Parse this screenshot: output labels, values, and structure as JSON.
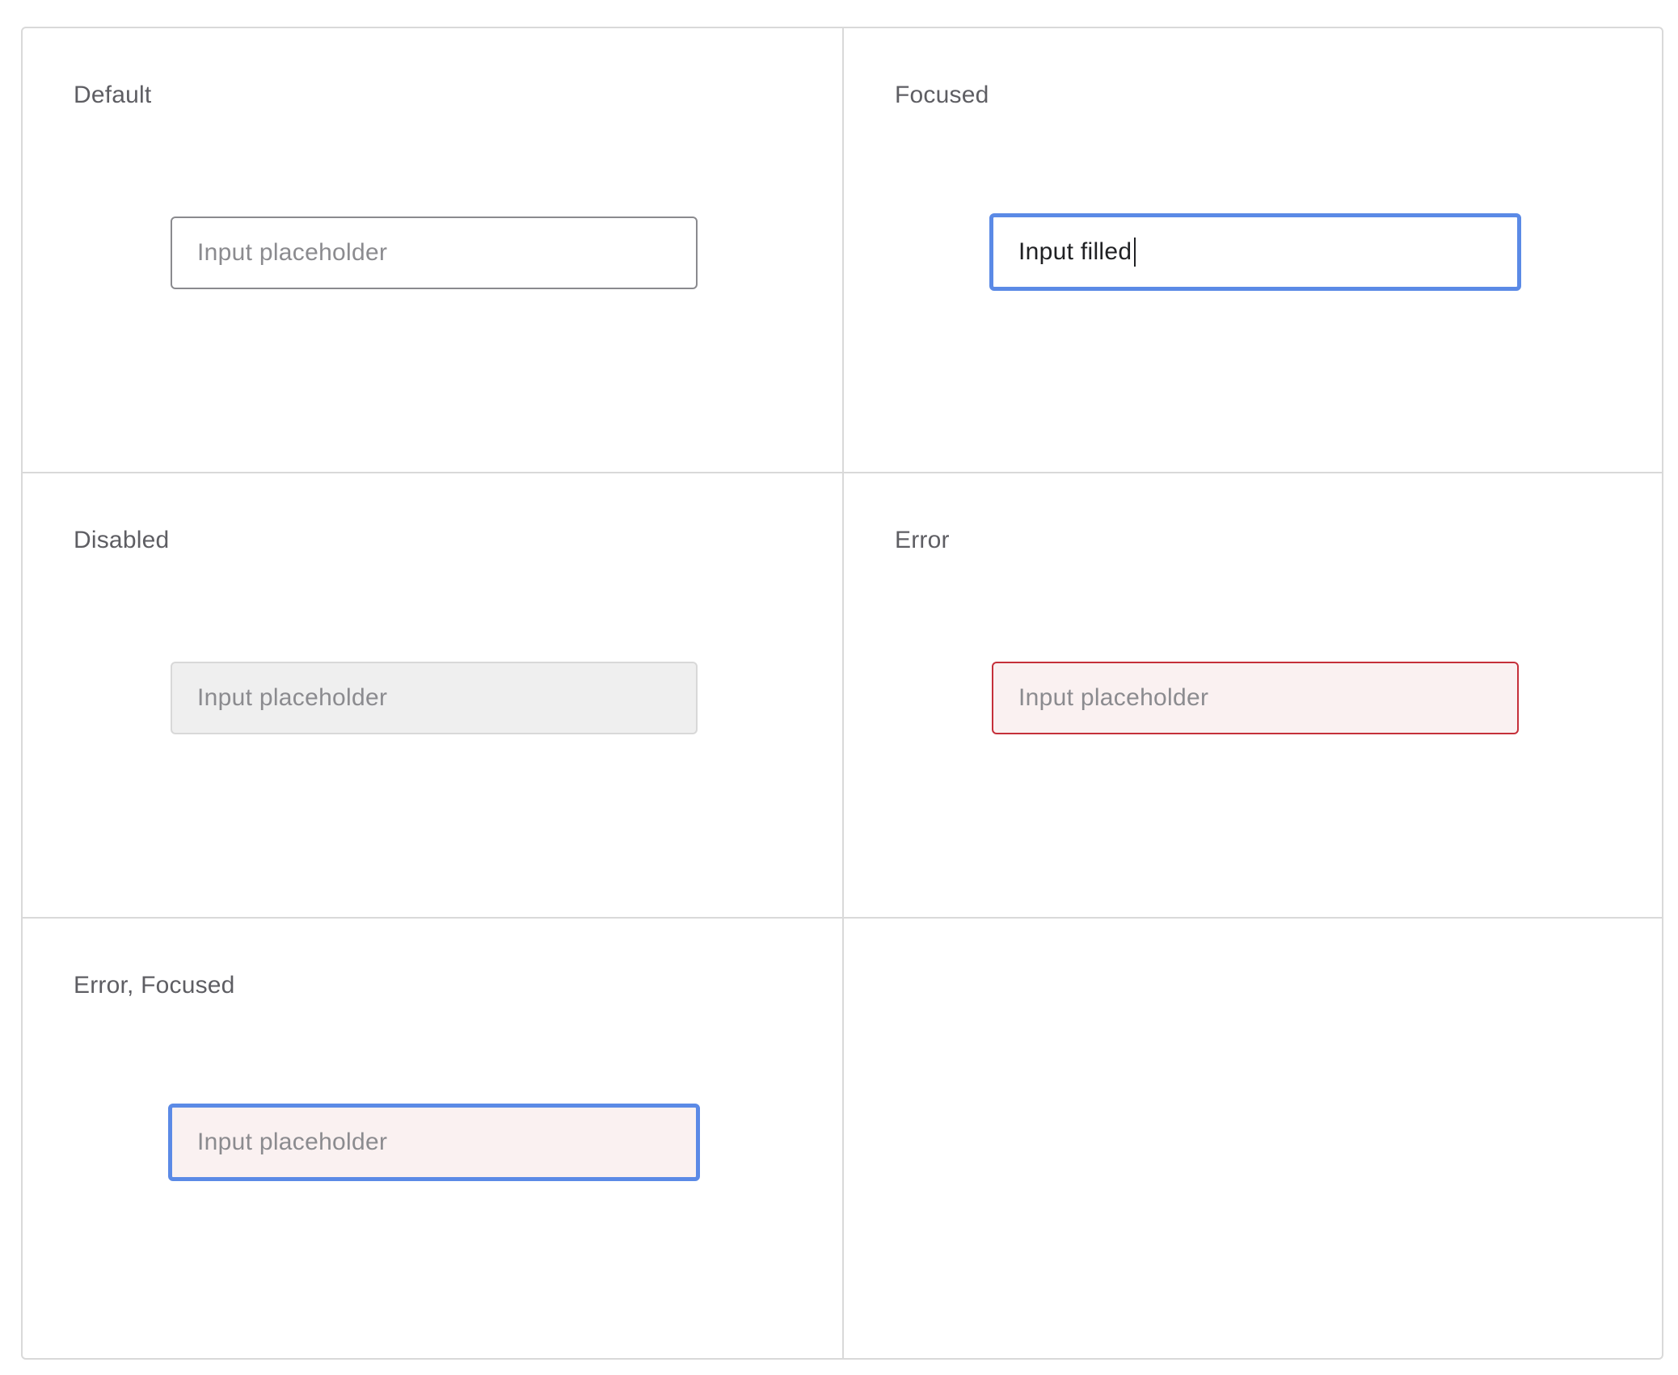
{
  "states": [
    {
      "label": "Default",
      "text": "Input placeholder"
    },
    {
      "label": "Focused",
      "text": "Input filled"
    },
    {
      "label": "Disabled",
      "text": "Input placeholder"
    },
    {
      "label": "Error",
      "text": "Input placeholder"
    },
    {
      "label": "Error, Focused",
      "text": "Input placeholder"
    }
  ],
  "colors": {
    "focus_border": "#5b8ae6",
    "error_border": "#c5303a",
    "error_background": "#faf1f1",
    "disabled_background": "#efefef",
    "default_border": "#8a8a8e"
  }
}
